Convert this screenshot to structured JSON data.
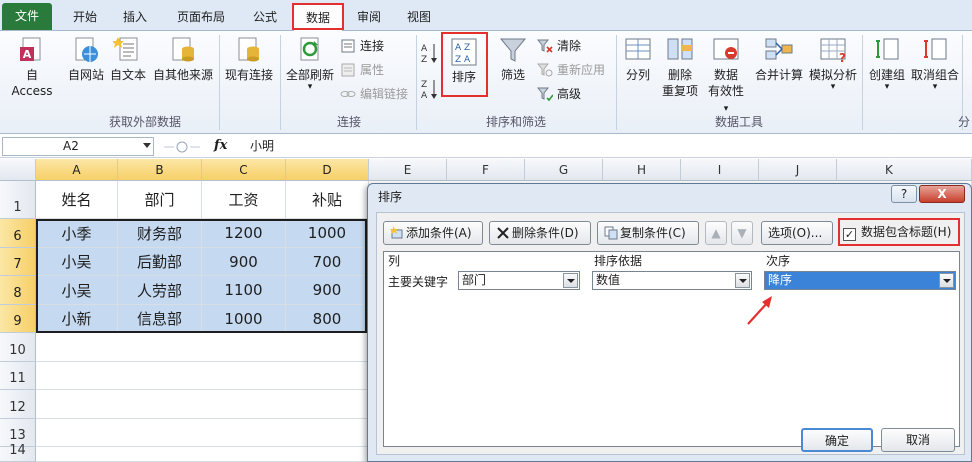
{
  "tabs": {
    "file": "文件",
    "items": [
      "开始",
      "插入",
      "页面布局",
      "公式",
      "数据",
      "审阅",
      "视图"
    ],
    "active": "数据"
  },
  "ribbon": {
    "get_external": {
      "buttons": [
        "自 Access",
        "自网站",
        "自文本",
        "自其他来源",
        "现有连接"
      ],
      "label": "获取外部数据"
    },
    "connections": {
      "refresh_all": "全部刷新",
      "connect": "连接",
      "properties": "属性",
      "edit_links": "编辑链接",
      "label": "连接"
    },
    "sort_filter": {
      "sort": "排序",
      "filter": "筛选",
      "clear": "清除",
      "reapply": "重新应用",
      "advanced": "高级",
      "label": "排序和筛选"
    },
    "data_tools": {
      "split": "分列",
      "remove_dup_1": "删除",
      "remove_dup_2": "重复项",
      "validation_1": "数据",
      "validation_2": "有效性",
      "consolidate": "合并计算",
      "what_if": "模拟分析",
      "label": "数据工具"
    },
    "outline": {
      "group": "创建组",
      "ungroup": "取消组合",
      "label": "分"
    }
  },
  "formula_bar": {
    "name_box": "A2",
    "fx": "fx",
    "content": "小明"
  },
  "sheet": {
    "columns": [
      "A",
      "B",
      "C",
      "D",
      "E",
      "F",
      "G",
      "H",
      "I",
      "J",
      "K"
    ],
    "row_numbers": [
      "1",
      "6",
      "7",
      "8",
      "9",
      "10",
      "11",
      "12",
      "13",
      "14"
    ],
    "header_row": [
      "姓名",
      "部门",
      "工资",
      "补贴"
    ],
    "rows": [
      [
        "小季",
        "财务部",
        "1200",
        "1000"
      ],
      [
        "小吴",
        "后勤部",
        "900",
        "700"
      ],
      [
        "小吴",
        "人劳部",
        "1100",
        "900"
      ],
      [
        "小新",
        "信息部",
        "1000",
        "800"
      ]
    ]
  },
  "dialog": {
    "title": "排序",
    "help": "?",
    "close": "X",
    "add_level": "添加条件(A)",
    "delete_level": "删除条件(D)",
    "copy_level": "复制条件(C)",
    "move_up": "▲",
    "move_down": "▼",
    "options": "选项(O)...",
    "has_headers": "数据包含标题(H)",
    "has_headers_checked": true,
    "col_header": "列",
    "sort_on_header": "排序依据",
    "order_header": "次序",
    "primary_key": "主要关键字",
    "column_value": "部门",
    "sort_on_value": "数值",
    "order_value": "降序",
    "ok": "确定",
    "cancel": "取消"
  },
  "colors": {
    "file_tab": "#2a7a3b",
    "highlight": "#e3302e",
    "selection": "#c5daf1",
    "accent": "#3a83d9"
  }
}
